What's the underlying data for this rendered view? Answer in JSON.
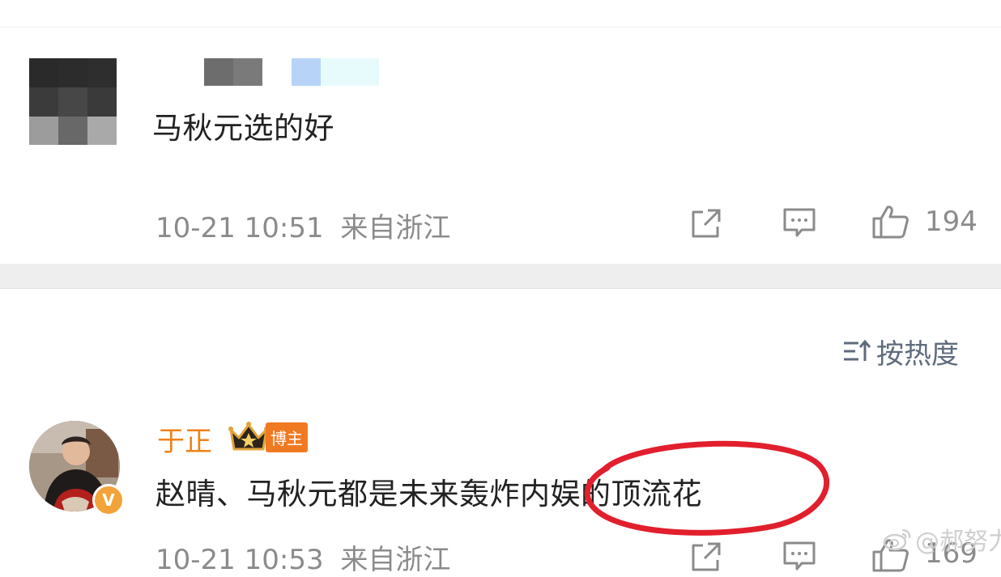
{
  "comment1": {
    "avatar_icon": "pixelated-avatar",
    "avatar_pixels": [
      "#2a2a2a",
      "#2c2c2c",
      "#2e2e2e",
      "#3b3b3b",
      "#474747",
      "#3a3a3a",
      "#9c9c9c",
      "#686868",
      "#a9a9a9"
    ],
    "text": "马秋元选的好",
    "time": "10-21 10:51",
    "location": "来自浙江",
    "like_count": "194"
  },
  "sort": {
    "icon": "sort-icon",
    "label": "按热度"
  },
  "comment2": {
    "avatar_icon": "user-photo",
    "verified_badge": "V",
    "user_name": "于正",
    "badge_icon": "crown-icon",
    "badge_label": "博主",
    "text": "赵晴、马秋元都是未来轰炸内娱的顶流花",
    "time": "10-21 10:53",
    "location": "来自浙江",
    "like_count": "169"
  },
  "watermark": {
    "icon": "weibo-logo-icon",
    "text": "@郝努力"
  },
  "colors": {
    "meta_gray": "#8b8b8b",
    "accent_orange": "#f08217",
    "annotation_red": "#e21f2d",
    "divider": "#eeeeee"
  }
}
